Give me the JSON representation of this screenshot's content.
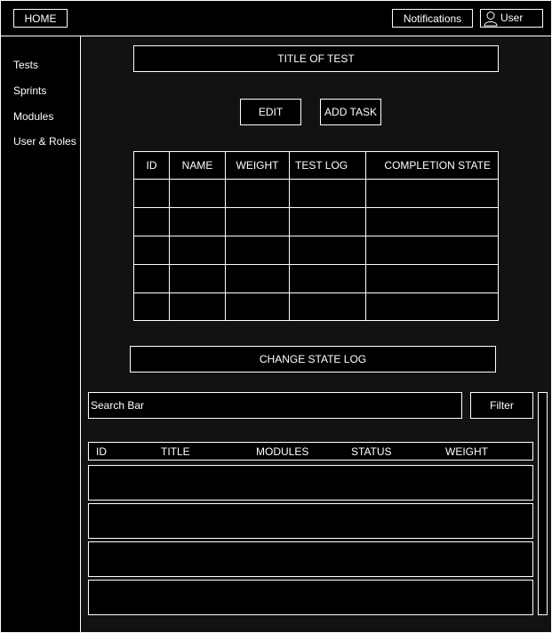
{
  "header": {
    "home_label": "HOME",
    "notifications_label": "Notifications",
    "user_label": "User"
  },
  "sidebar": {
    "items": [
      {
        "label": "Tests"
      },
      {
        "label": "Sprints"
      },
      {
        "label": "Modules"
      },
      {
        "label": "User & Roles"
      }
    ]
  },
  "main": {
    "title": "TITLE OF TEST",
    "edit_label": "EDIT",
    "add_task_label": "ADD TASK",
    "tasks_table": {
      "columns": [
        "ID",
        "NAME",
        "WEIGHT",
        "TEST LOG",
        "COMPLETION STATE"
      ],
      "rows": [
        [
          "",
          "",
          "",
          "",
          ""
        ],
        [
          "",
          "",
          "",
          "",
          ""
        ],
        [
          "",
          "",
          "",
          "",
          ""
        ],
        [
          "",
          "",
          "",
          "",
          ""
        ],
        [
          "",
          "",
          "",
          "",
          ""
        ]
      ]
    },
    "change_state_log_label": "CHANGE STATE LOG",
    "search": {
      "value": "Search Bar"
    },
    "filter_label": "Filter",
    "log_list": {
      "columns": [
        "ID",
        "TITLE",
        "MODULES",
        "STATUS",
        "WEIGHT"
      ],
      "rows": [
        {},
        {},
        {},
        {}
      ]
    }
  }
}
